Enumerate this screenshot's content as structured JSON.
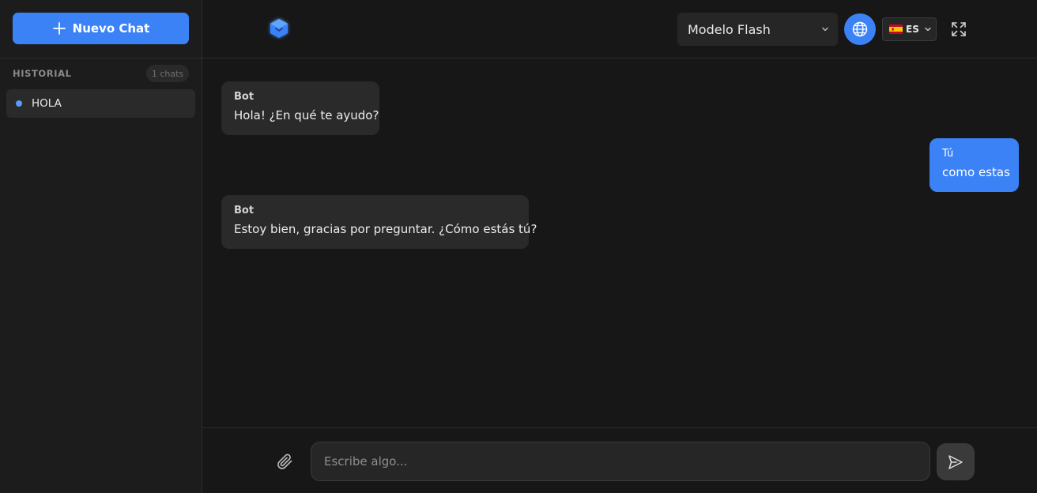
{
  "sidebar": {
    "new_chat_label": "Nuevo Chat",
    "history_title": "HISTORIAL",
    "history_count": "1 chats",
    "items": [
      {
        "label": "HOLA"
      }
    ]
  },
  "header": {
    "model_label": "Modelo Flash",
    "language_code": "ES",
    "language_flag": "spain-flag-icon",
    "accent_color": "#3b82f6"
  },
  "messages": [
    {
      "role": "bot",
      "sender": "Bot",
      "text": "Hola! ¿En qué te ayudo?"
    },
    {
      "role": "user",
      "sender": "Tú",
      "text": "como estas"
    },
    {
      "role": "bot",
      "sender": "Bot",
      "text": "Estoy bien, gracias por preguntar. ¿Cómo estás tú?"
    }
  ],
  "composer": {
    "placeholder": "Escribe algo..."
  }
}
